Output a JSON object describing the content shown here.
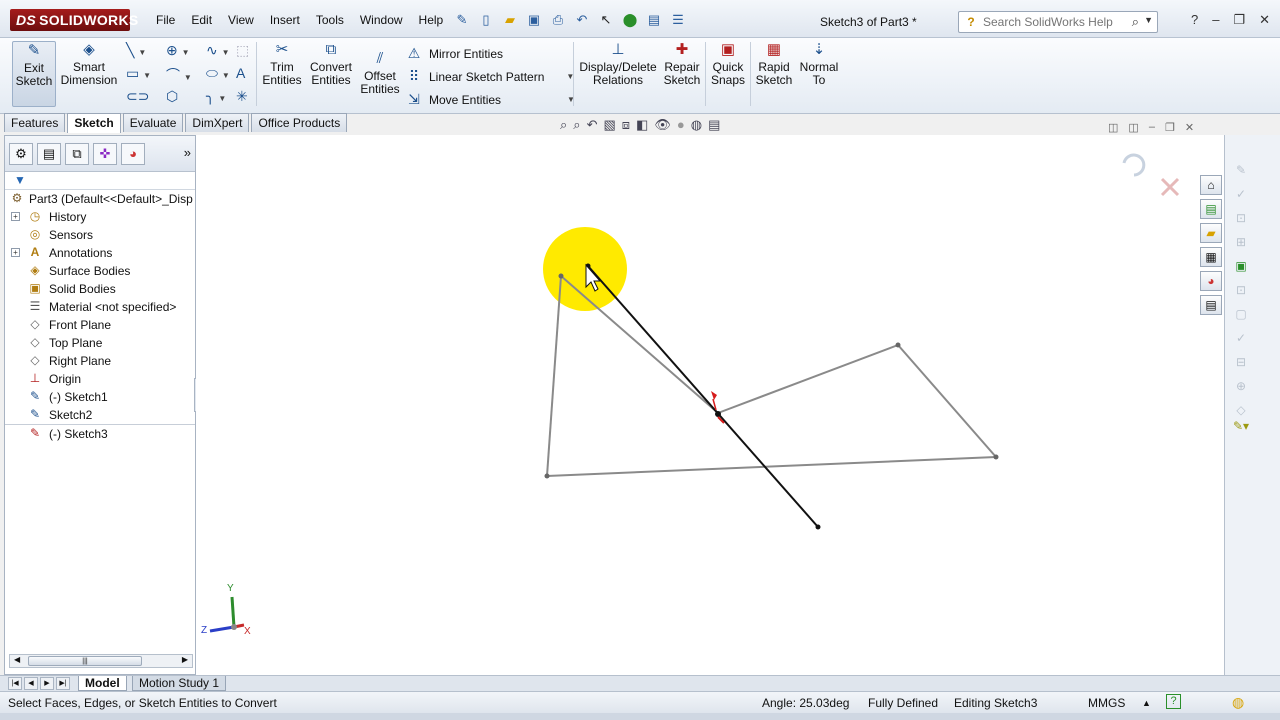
{
  "app": {
    "logo_text": "SOLIDWORKS",
    "logo_mark": "DS"
  },
  "menu": [
    "File",
    "Edit",
    "View",
    "Insert",
    "Tools",
    "Window",
    "Help"
  ],
  "window": {
    "document_title": "Sketch3 of Part3 *"
  },
  "search": {
    "placeholder": "Search SolidWorks Help"
  },
  "command_manager": {
    "exit_sketch": "Exit Sketch",
    "smart_dimension": "Smart Dimension",
    "trim_entities": "Trim Entities",
    "convert_entities": "Convert Entities",
    "offset_entities": "Offset Entities",
    "mirror_entities": "Mirror Entities",
    "linear_sketch_pattern": "Linear Sketch Pattern",
    "move_entities": "Move Entities",
    "display_delete_relations": "Display/Delete Relations",
    "repair_sketch": "Repair Sketch",
    "quick_snaps": "Quick Snaps",
    "rapid_sketch": "Rapid Sketch",
    "normal_to": "Normal To"
  },
  "tabs": [
    "Features",
    "Sketch",
    "Evaluate",
    "DimXpert",
    "Office Products"
  ],
  "active_tab": "Sketch",
  "feature_tree": {
    "root": "Part3  (Default<<Default>_Disp",
    "items": [
      {
        "label": "History",
        "icon": "history-icon"
      },
      {
        "label": "Sensors",
        "icon": "sensors-icon"
      },
      {
        "label": "Annotations",
        "icon": "annotations-icon"
      },
      {
        "label": "Surface Bodies",
        "icon": "surface-bodies-icon"
      },
      {
        "label": "Solid Bodies",
        "icon": "solid-bodies-icon"
      },
      {
        "label": "Material <not specified>",
        "icon": "material-icon"
      },
      {
        "label": "Front Plane",
        "icon": "plane-icon"
      },
      {
        "label": "Top Plane",
        "icon": "plane-icon"
      },
      {
        "label": "Right Plane",
        "icon": "plane-icon"
      },
      {
        "label": "Origin",
        "icon": "origin-icon"
      },
      {
        "label": "(-) Sketch1",
        "icon": "sketch-icon"
      },
      {
        "label": "Sketch2",
        "icon": "sketch-icon"
      },
      {
        "label": "(-) Sketch3",
        "icon": "sketch-edit-icon"
      }
    ]
  },
  "triad": {
    "y": "Y",
    "z": "Z",
    "x": "X"
  },
  "bottom_tabs": {
    "model": "Model",
    "motion_study": "Motion Study 1"
  },
  "status": {
    "message": "Select Faces, Edges, or Sketch Entities to Convert",
    "angle": "Angle: 25.03deg",
    "definition": "Fully Defined",
    "editing": "Editing Sketch3",
    "units": "MMGS"
  },
  "colors": {
    "sketch_line": "#8a8a8a",
    "active_line": "#111111",
    "highlight": "#ffea00",
    "accent": "#a51c1c"
  }
}
